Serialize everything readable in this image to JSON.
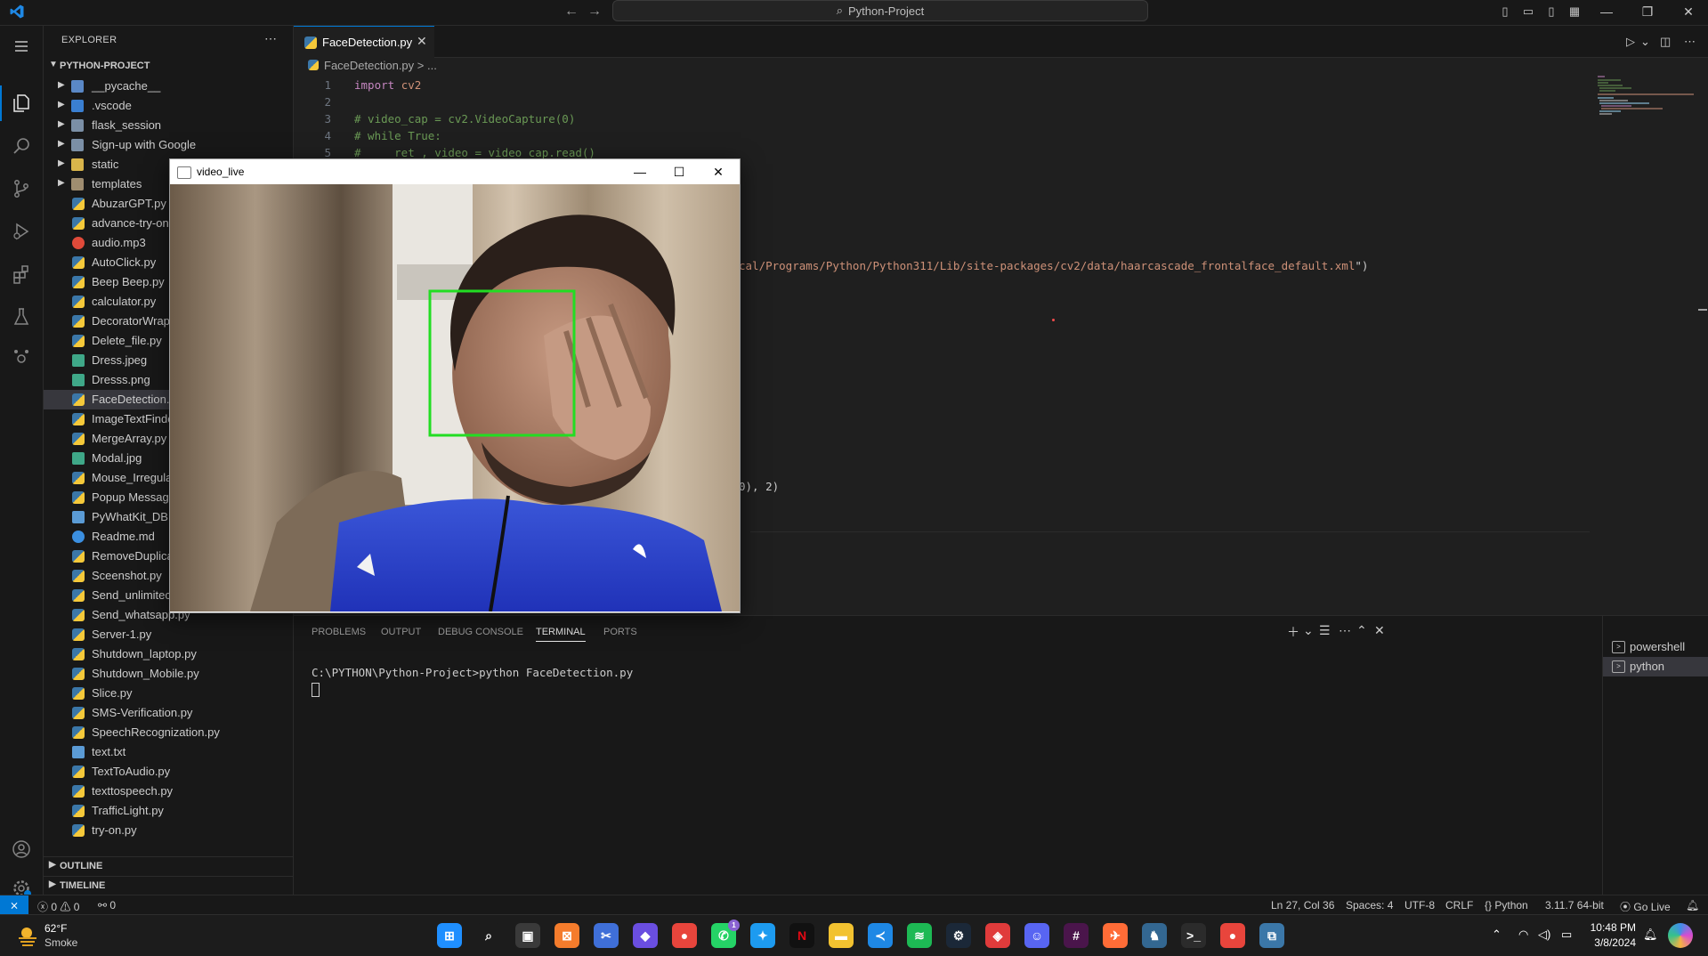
{
  "titlebar": {
    "command_center": "Python-Project",
    "back_icon": "arrow-left-icon",
    "forward_icon": "arrow-right-icon"
  },
  "explorer": {
    "title": "EXPLORER",
    "project": "PYTHON-PROJECT",
    "folders": [
      {
        "label": "__pycache__",
        "kind": "pc"
      },
      {
        "label": ".vscode",
        "kind": "vs"
      },
      {
        "label": "flask_session",
        "kind": "plain"
      },
      {
        "label": "Sign-up with Google",
        "kind": "plain"
      },
      {
        "label": "static",
        "kind": "gold"
      },
      {
        "label": "templates",
        "kind": "tmpl"
      }
    ],
    "files": [
      {
        "label": "AbuzarGPT.py",
        "type": "py"
      },
      {
        "label": "advance-try-on",
        "type": "py"
      },
      {
        "label": "audio.mp3",
        "type": "mp3"
      },
      {
        "label": "AutoClick.py",
        "type": "py"
      },
      {
        "label": "Beep Beep.py",
        "type": "py"
      },
      {
        "label": "calculator.py",
        "type": "py"
      },
      {
        "label": "DecoratorWrap",
        "type": "py"
      },
      {
        "label": "Delete_file.py",
        "type": "py"
      },
      {
        "label": "Dress.jpeg",
        "type": "img"
      },
      {
        "label": "Dresss.png",
        "type": "img"
      },
      {
        "label": "FaceDetection.",
        "type": "py",
        "selected": true
      },
      {
        "label": "ImageTextFinde",
        "type": "py"
      },
      {
        "label": "MergeArray.py",
        "type": "py"
      },
      {
        "label": "Modal.jpg",
        "type": "img"
      },
      {
        "label": "Mouse_Irregula",
        "type": "py"
      },
      {
        "label": "Popup Messag",
        "type": "py"
      },
      {
        "label": "PyWhatKit_DB.",
        "type": "txt"
      },
      {
        "label": "Readme.md",
        "type": "info"
      },
      {
        "label": "RemoveDuplica",
        "type": "py"
      },
      {
        "label": "Sceenshot.py",
        "type": "py"
      },
      {
        "label": "Send_unlimitec",
        "type": "py"
      },
      {
        "label": "Send_whatsapp.py",
        "type": "py"
      },
      {
        "label": "Server-1.py",
        "type": "py"
      },
      {
        "label": "Shutdown_laptop.py",
        "type": "py"
      },
      {
        "label": "Shutdown_Mobile.py",
        "type": "py"
      },
      {
        "label": "Slice.py",
        "type": "py"
      },
      {
        "label": "SMS-Verification.py",
        "type": "py"
      },
      {
        "label": "SpeechRecognization.py",
        "type": "py"
      },
      {
        "label": "text.txt",
        "type": "txt"
      },
      {
        "label": "TextToAudio.py",
        "type": "py"
      },
      {
        "label": "texttospeech.py",
        "type": "py"
      },
      {
        "label": "TrafficLight.py",
        "type": "py"
      },
      {
        "label": "try-on.py",
        "type": "py"
      }
    ],
    "outline": "OUTLINE",
    "timeline": "TIMELINE"
  },
  "editor": {
    "tab_label": "FaceDetection.py",
    "breadcrumb_file": "FaceDetection.py",
    "breadcrumb_rest": "> ...",
    "lines": [
      {
        "n": "1",
        "parts": [
          {
            "c": "kw",
            "t": "import"
          },
          {
            "c": "plain",
            "t": " "
          },
          {
            "c": "str",
            "t": "cv2"
          }
        ]
      },
      {
        "n": "2",
        "parts": []
      },
      {
        "n": "3",
        "parts": [
          {
            "c": "cm",
            "t": "# video_cap = cv2.VideoCapture(0)"
          }
        ]
      },
      {
        "n": "4",
        "parts": [
          {
            "c": "cm",
            "t": "# while True:"
          }
        ]
      },
      {
        "n": "5",
        "parts": [
          {
            "c": "cm",
            "t": "#     ret , video = video_cap.read()"
          }
        ]
      }
    ],
    "hidden_line_1": {
      "parts": [
        {
          "c": "str",
          "t": "cal/Programs/Python/Python311/Lib/site-packages/cv2/data/haarcascade_frontalface_default.xml"
        },
        {
          "c": "plain",
          "t": "\")"
        }
      ]
    },
    "hidden_line_2": {
      "parts": [
        {
          "c": "plain",
          "t": "0), 2)"
        }
      ]
    }
  },
  "panel": {
    "tabs": [
      "PROBLEMS",
      "OUTPUT",
      "DEBUG CONSOLE",
      "TERMINAL",
      "PORTS"
    ],
    "active_tab": "TERMINAL",
    "terminal_line": "C:\\PYTHON\\Python-Project>python FaceDetection.py",
    "terminals": [
      {
        "label": "powershell",
        "selected": false
      },
      {
        "label": "python",
        "selected": true
      }
    ]
  },
  "statusbar": {
    "errors": "0",
    "warnings": "0",
    "ports": "0",
    "position": "Ln 27, Col 36",
    "spaces": "Spaces: 4",
    "encoding": "UTF-8",
    "eol": "CRLF",
    "language": "Python",
    "interpreter": "3.11.7 64-bit",
    "golive": "Go Live"
  },
  "video_window": {
    "title": "video_live",
    "detected_box_color": "#22dd22"
  },
  "taskbar": {
    "temp": "62°F",
    "weather": "Smoke",
    "time": "10:48 PM",
    "date": "3/8/2024",
    "whatsapp_badge": "1",
    "apps": [
      "windows-start-icon",
      "search-icon",
      "task-view-icon",
      "xampp-icon",
      "snipping-icon",
      "prime-icon",
      "chrome-icon",
      "whatsapp-icon",
      "twitter-icon",
      "netflix-icon",
      "file-explorer-icon",
      "vscode-icon",
      "spotify-icon",
      "steam-icon",
      "anydesk-icon",
      "discord-icon",
      "slack-icon",
      "postman-icon",
      "postgres-icon",
      "terminal-icon",
      "chrome-profile-icon",
      "python-icon"
    ]
  },
  "colors": {
    "accent": "#0078d4",
    "editor_bg": "#1f1f1f",
    "sidebar_bg": "#181818"
  }
}
